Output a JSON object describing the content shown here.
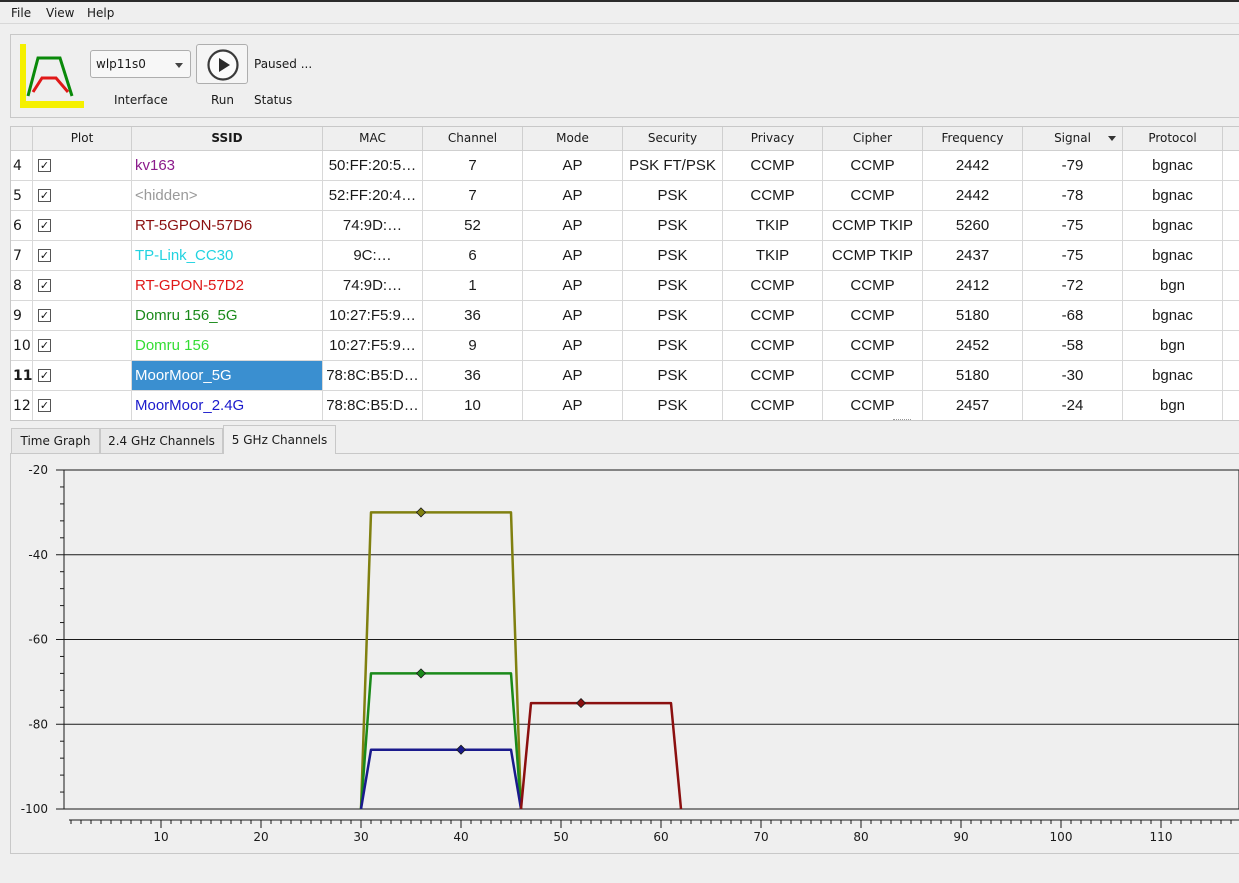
{
  "menu": [
    "File",
    "View",
    "Help"
  ],
  "toolbar": {
    "interface_value": "wlp11s0",
    "status_value": "Paused ...",
    "labels": {
      "interface": "Interface",
      "run": "Run",
      "status": "Status"
    },
    "icons": {
      "logo": "signal-app-logo-icon",
      "run": "play-icon",
      "dropdown": "chevron-down-icon"
    }
  },
  "table": {
    "headers": [
      "Plot",
      "SSID",
      "MAC",
      "Channel",
      "Mode",
      "Security",
      "Privacy",
      "Cipher",
      "Frequency",
      "Signal",
      "Protocol"
    ],
    "sorted_column": "Signal",
    "rows": [
      {
        "num": "4",
        "ssid": "kv163",
        "color": "#8b1a8b",
        "mac": "50:FF:20:5…",
        "channel": "7",
        "mode": "AP",
        "security": "PSK FT/PSK",
        "privacy": "CCMP",
        "cipher": "CCMP",
        "frequency": "2442",
        "signal": "-79",
        "protocol": "bgnac"
      },
      {
        "num": "5",
        "ssid": "<hidden>",
        "color": "#9a9a9a",
        "mac": "52:FF:20:4…",
        "channel": "7",
        "mode": "AP",
        "security": "PSK",
        "privacy": "CCMP",
        "cipher": "CCMP",
        "frequency": "2442",
        "signal": "-78",
        "protocol": "bgnac"
      },
      {
        "num": "6",
        "ssid": "RT-5GPON-57D6",
        "color": "#8b1010",
        "mac": "74:9D:…",
        "channel": "52",
        "mode": "AP",
        "security": "PSK",
        "privacy": "TKIP",
        "cipher": "CCMP TKIP",
        "frequency": "5260",
        "signal": "-75",
        "protocol": "bgnac"
      },
      {
        "num": "7",
        "ssid": "TP-Link_CC30",
        "color": "#22d3e0",
        "mac": "9C:…",
        "channel": "6",
        "mode": "AP",
        "security": "PSK",
        "privacy": "TKIP",
        "cipher": "CCMP TKIP",
        "frequency": "2437",
        "signal": "-75",
        "protocol": "bgnac"
      },
      {
        "num": "8",
        "ssid": "RT-GPON-57D2",
        "color": "#e01818",
        "mac": "74:9D:…",
        "channel": "1",
        "mode": "AP",
        "security": "PSK",
        "privacy": "CCMP",
        "cipher": "CCMP",
        "frequency": "2412",
        "signal": "-72",
        "protocol": "bgn"
      },
      {
        "num": "9",
        "ssid": "Domru 156_5G",
        "color": "#1a8a1a",
        "mac": "10:27:F5:9…",
        "channel": "36",
        "mode": "AP",
        "security": "PSK",
        "privacy": "CCMP",
        "cipher": "CCMP",
        "frequency": "5180",
        "signal": "-68",
        "protocol": "bgnac"
      },
      {
        "num": "10",
        "ssid": "Domru 156",
        "color": "#33dd33",
        "mac": "10:27:F5:9…",
        "channel": "9",
        "mode": "AP",
        "security": "PSK",
        "privacy": "CCMP",
        "cipher": "CCMP",
        "frequency": "2452",
        "signal": "-58",
        "protocol": "bgn"
      },
      {
        "num": "11",
        "ssid": "MoorMoor_5G",
        "color": "#8b8b10",
        "mac": "78:8C:B5:D…",
        "channel": "36",
        "mode": "AP",
        "security": "PSK",
        "privacy": "CCMP",
        "cipher": "CCMP",
        "frequency": "5180",
        "signal": "-30",
        "protocol": "bgnac",
        "selected": true
      },
      {
        "num": "12",
        "ssid": "MoorMoor_2.4G",
        "color": "#1a1acc",
        "mac": "78:8C:B5:D…",
        "channel": "10",
        "mode": "AP",
        "security": "PSK",
        "privacy": "CCMP",
        "cipher": "CCMP",
        "frequency": "2457",
        "signal": "-24",
        "protocol": "bgn"
      }
    ]
  },
  "tabs": [
    "Time Graph",
    "2.4 GHz Channels",
    "5 GHz Channels"
  ],
  "active_tab": "5 GHz Channels",
  "chart_data": {
    "type": "line",
    "title": "",
    "xlabel": "",
    "ylabel": "",
    "xlim": [
      0,
      117
    ],
    "ylim": [
      -100,
      -20
    ],
    "xticks": [
      10,
      20,
      30,
      40,
      50,
      60,
      70,
      80,
      90,
      100,
      110
    ],
    "yticks": [
      -20,
      -40,
      -60,
      -80,
      -100
    ],
    "grid": "horizontal",
    "series": [
      {
        "color": "#808010",
        "center": 36,
        "points": [
          [
            30,
            -100
          ],
          [
            31,
            -30
          ],
          [
            45,
            -30
          ],
          [
            46,
            -100
          ]
        ]
      },
      {
        "color": "#1a8a1a",
        "center": 36,
        "points": [
          [
            30,
            -100
          ],
          [
            31,
            -68
          ],
          [
            45,
            -68
          ],
          [
            46,
            -100
          ]
        ]
      },
      {
        "color": "#1a1a8c",
        "center": 40,
        "points": [
          [
            30,
            -100
          ],
          [
            31,
            -86
          ],
          [
            45,
            -86
          ],
          [
            46,
            -100
          ]
        ]
      },
      {
        "color": "#8b1010",
        "center": 52,
        "points": [
          [
            46,
            -100
          ],
          [
            47,
            -75
          ],
          [
            61,
            -75
          ],
          [
            62,
            -100
          ]
        ]
      }
    ]
  }
}
